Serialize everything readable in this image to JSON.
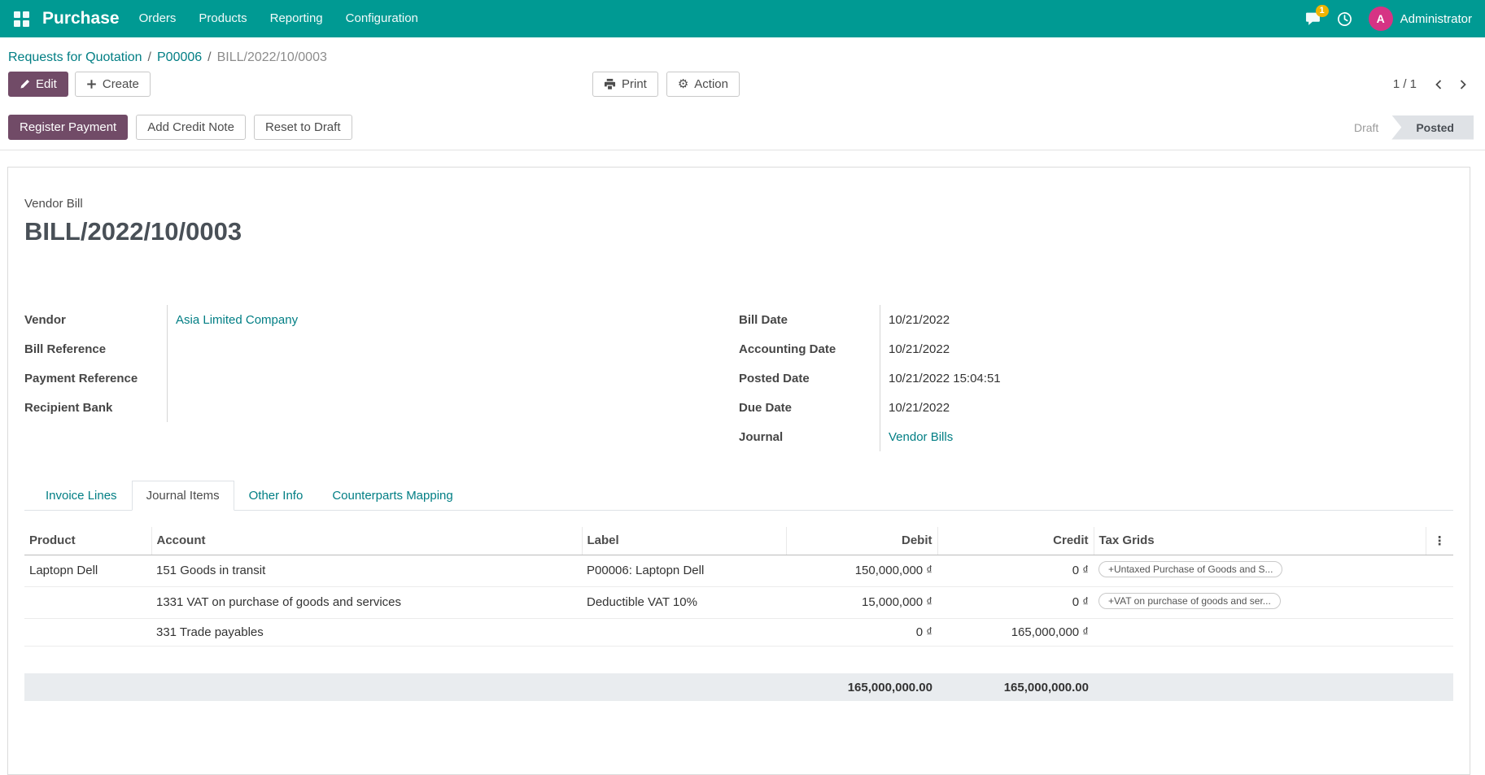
{
  "navbar": {
    "app_name": "Purchase",
    "menu": [
      "Orders",
      "Products",
      "Reporting",
      "Configuration"
    ],
    "messages_badge": "1",
    "user": {
      "name": "Administrator",
      "avatar_initial": "A"
    }
  },
  "breadcrumb": {
    "items": [
      "Requests for Quotation",
      "P00006",
      "BILL/2022/10/0003"
    ],
    "separator": "/"
  },
  "control_panel": {
    "edit_label": "Edit",
    "create_label": "Create",
    "print_label": "Print",
    "action_label": "Action",
    "pager": "1 / 1"
  },
  "statusbar": {
    "register_payment_label": "Register Payment",
    "add_credit_note_label": "Add Credit Note",
    "reset_to_draft_label": "Reset to Draft",
    "states": [
      {
        "label": "Draft",
        "active": false
      },
      {
        "label": "Posted",
        "active": true
      }
    ]
  },
  "document": {
    "type_label": "Vendor Bill",
    "title": "BILL/2022/10/0003",
    "fields_left": [
      {
        "label": "Vendor",
        "value": "Asia Limited Company"
      },
      {
        "label": "Bill Reference",
        "value": ""
      },
      {
        "label": "Payment Reference",
        "value": ""
      },
      {
        "label": "Recipient Bank",
        "value": ""
      }
    ],
    "fields_right": [
      {
        "label": "Bill Date",
        "value": "10/21/2022"
      },
      {
        "label": "Accounting Date",
        "value": "10/21/2022"
      },
      {
        "label": "Posted Date",
        "value": "10/21/2022 15:04:51"
      },
      {
        "label": "Due Date",
        "value": "10/21/2022"
      },
      {
        "label": "Journal",
        "value": "Vendor Bills"
      }
    ],
    "tabs": [
      "Invoice Lines",
      "Journal Items",
      "Other Info",
      "Counterparts Mapping"
    ],
    "active_tab": "Journal Items"
  },
  "journal_items_table": {
    "columns": [
      "Product",
      "Account",
      "Label",
      "Debit",
      "Credit",
      "Tax Grids"
    ],
    "rows": [
      {
        "product": "Laptopn Dell",
        "account": "151 Goods in transit",
        "label": "P00006: Laptopn Dell",
        "debit": "150,000,000 ₫",
        "credit": "0 ₫",
        "tax_grid": "+Untaxed Purchase of Goods and S..."
      },
      {
        "product": "",
        "account": "1331 VAT on purchase of goods and services",
        "label": "Deductible VAT 10%",
        "debit": "15,000,000 ₫",
        "credit": "0 ₫",
        "tax_grid": "+VAT on purchase of goods and ser..."
      },
      {
        "product": "",
        "account": "331 Trade payables",
        "label": "",
        "debit": "0 ₫",
        "credit": "165,000,000 ₫",
        "tax_grid": ""
      }
    ],
    "totals": {
      "debit": "165,000,000.00",
      "credit": "165,000,000.00"
    }
  },
  "colors": {
    "navbar_bg": "#009a93",
    "primary": "#714b67",
    "link": "#017e84",
    "avatar_bg": "#d63384",
    "badge_bg": "#efb400",
    "status_active_bg": "#dfe2e6"
  }
}
